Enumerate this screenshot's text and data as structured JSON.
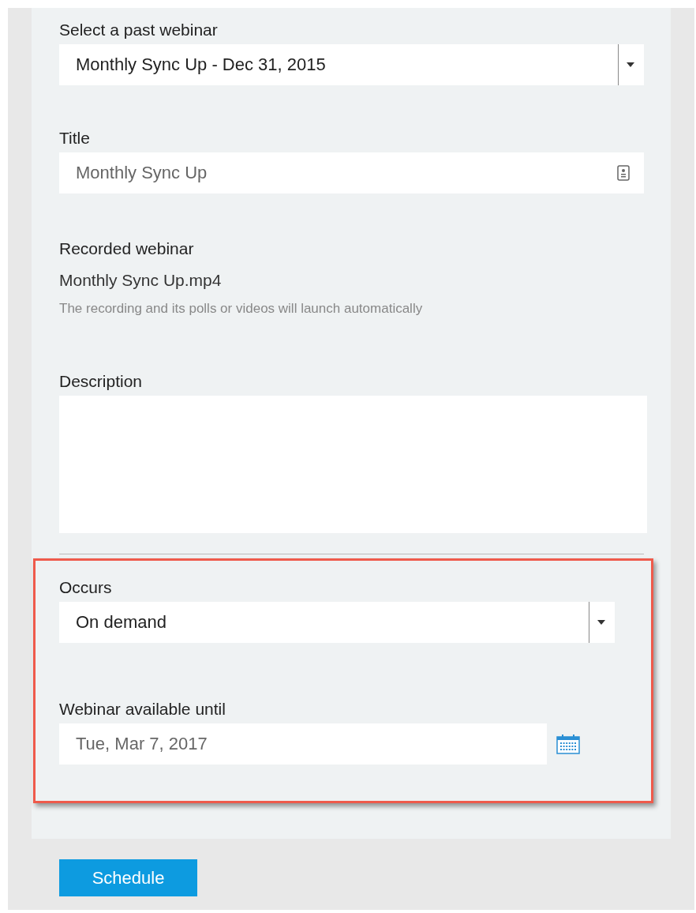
{
  "past_webinar": {
    "label": "Select a past webinar",
    "value": "Monthly Sync Up - Dec 31, 2015"
  },
  "title": {
    "label": "Title",
    "value": "Monthly Sync Up"
  },
  "recording": {
    "label": "Recorded webinar",
    "file": "Monthly Sync Up.mp4",
    "hint": "The recording and its polls or videos will launch automatically"
  },
  "description": {
    "label": "Description"
  },
  "occurs": {
    "label": "Occurs",
    "value": "On demand"
  },
  "available_until": {
    "label": "Webinar available until",
    "value": "Tue, Mar 7, 2017"
  },
  "schedule_button": "Schedule"
}
